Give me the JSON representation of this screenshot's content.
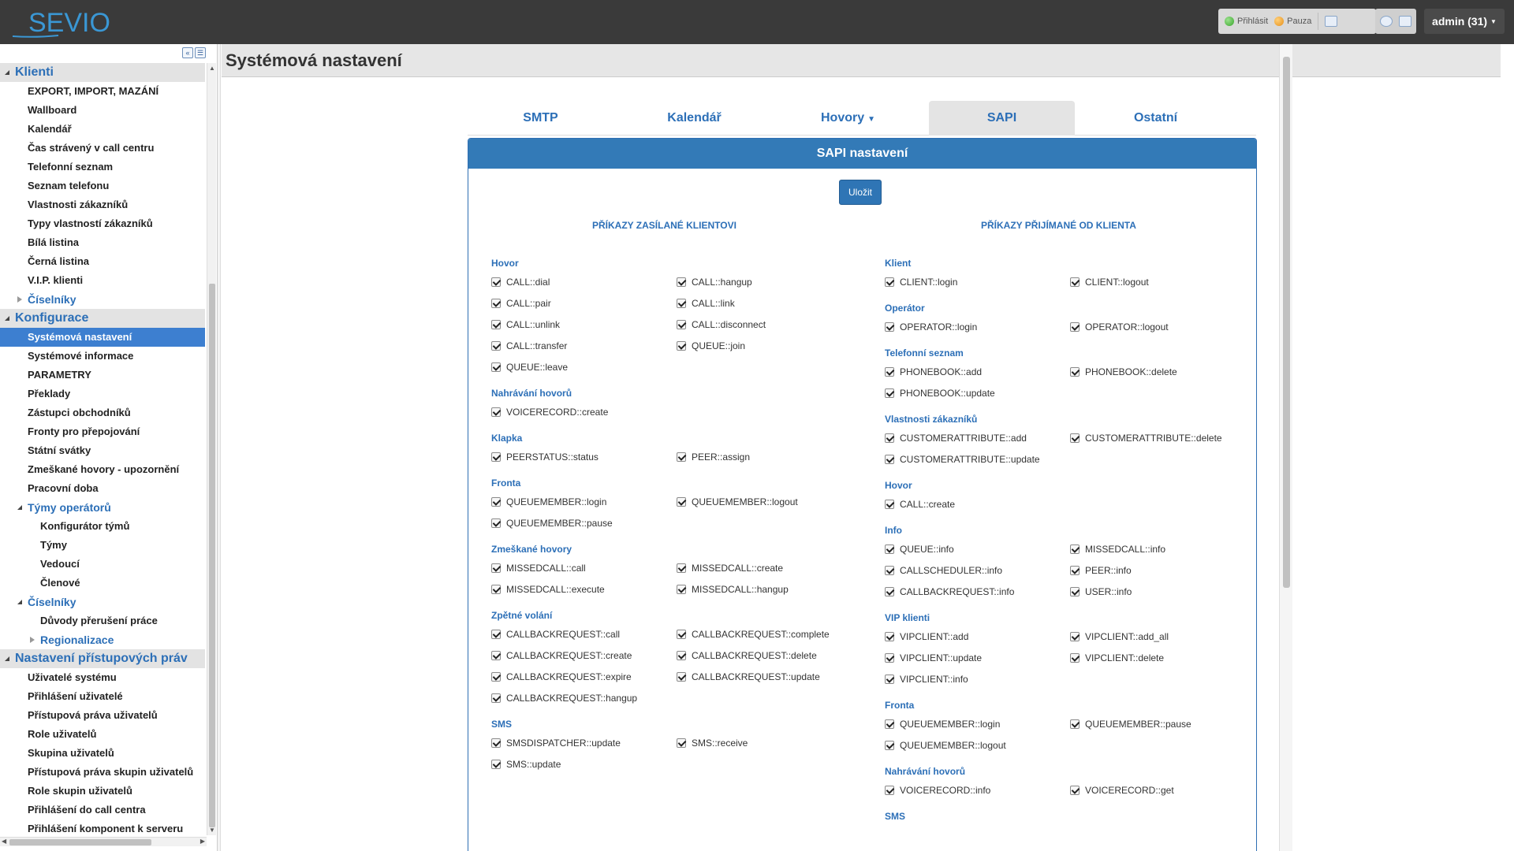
{
  "app": {
    "logo_text": "SEVIO"
  },
  "topbar": {
    "status_login": "Přihlásit",
    "status_pause": "Pauza",
    "user_label": "admin (31)"
  },
  "sidebar": {
    "items": [
      {
        "label": "Klienti",
        "level": 0,
        "tri": "open"
      },
      {
        "label": "EXPORT, IMPORT, MAZÁNÍ",
        "level": 1
      },
      {
        "label": "Wallboard",
        "level": 1
      },
      {
        "label": "Kalendář",
        "level": 1
      },
      {
        "label": "Čas strávený v call centru",
        "level": 1
      },
      {
        "label": "Telefonní seznam",
        "level": 1
      },
      {
        "label": "Seznam telefonu",
        "level": 1
      },
      {
        "label": "Vlastnosti zákazníků",
        "level": 1
      },
      {
        "label": "Typy vlastností zákazníků",
        "level": 1
      },
      {
        "label": "Bílá listina",
        "level": 1
      },
      {
        "label": "Černá listina",
        "level": 1
      },
      {
        "label": "V.I.P. klienti",
        "level": 1
      },
      {
        "label": "Číselníky",
        "level": 1,
        "group": true,
        "tri": "closed"
      },
      {
        "label": "Konfigurace",
        "level": 0,
        "tri": "open"
      },
      {
        "label": "Systémová nastavení",
        "level": 1,
        "active": true
      },
      {
        "label": "Systémové informace",
        "level": 1
      },
      {
        "label": "PARAMETRY",
        "level": 1
      },
      {
        "label": "Překlady",
        "level": 1
      },
      {
        "label": "Zástupci obchodníků",
        "level": 1
      },
      {
        "label": "Fronty pro přepojování",
        "level": 1
      },
      {
        "label": "Státní svátky",
        "level": 1
      },
      {
        "label": "Zmeškané hovory - upozornění",
        "level": 1
      },
      {
        "label": "Pracovní doba",
        "level": 1
      },
      {
        "label": "Týmy operátorů",
        "level": 1,
        "group": true,
        "tri": "open"
      },
      {
        "label": "Konfigurátor týmů",
        "level": 2
      },
      {
        "label": "Týmy",
        "level": 2
      },
      {
        "label": "Vedoucí",
        "level": 2
      },
      {
        "label": "Členové",
        "level": 2
      },
      {
        "label": "Číselníky",
        "level": 1,
        "group": true,
        "tri": "open"
      },
      {
        "label": "Důvody přerušení práce",
        "level": 2
      },
      {
        "label": "Regionalizace",
        "level": 2,
        "group": true,
        "tri": "closed"
      },
      {
        "label": "Nastavení přístupových práv",
        "level": 0,
        "tri": "open"
      },
      {
        "label": "Uživatelé systému",
        "level": 1
      },
      {
        "label": "Přihlášení uživatelé",
        "level": 1
      },
      {
        "label": "Přístupová práva uživatelů",
        "level": 1
      },
      {
        "label": "Role uživatelů",
        "level": 1
      },
      {
        "label": "Skupina uživatelů",
        "level": 1
      },
      {
        "label": "Přístupová práva skupin uživatelů",
        "level": 1
      },
      {
        "label": "Role skupin uživatelů",
        "level": 1
      },
      {
        "label": "Přihlášení do call centra",
        "level": 1
      },
      {
        "label": "Přihlášení komponent k serveru",
        "level": 1
      }
    ]
  },
  "page": {
    "title": "Systémová nastavení"
  },
  "tabs": [
    {
      "label": "SMTP",
      "active": false
    },
    {
      "label": "Kalendář",
      "active": false
    },
    {
      "label": "Hovory",
      "active": false,
      "dropdown": true
    },
    {
      "label": "SAPI",
      "active": true
    },
    {
      "label": "Ostatní",
      "active": false
    }
  ],
  "panel": {
    "title": "SAPI nastavení",
    "save_label": "Uložit",
    "left_heading": "PŘÍKAZY ZASÍLANÉ KLIENTOVI",
    "right_heading": "PŘÍKAZY PŘIJÍMANÉ OD KLIENTA",
    "left_sections": [
      {
        "title": "Hovor",
        "items": [
          "CALL::dial",
          "CALL::hangup",
          "CALL::pair",
          "CALL::link",
          "CALL::unlink",
          "CALL::disconnect",
          "CALL::transfer",
          "QUEUE::join",
          "QUEUE::leave"
        ]
      },
      {
        "title": "Nahrávání hovorů",
        "items": [
          "VOICERECORD::create"
        ]
      },
      {
        "title": "Klapka",
        "items": [
          "PEERSTATUS::status",
          "PEER::assign"
        ]
      },
      {
        "title": "Fronta",
        "items": [
          "QUEUEMEMBER::login",
          "QUEUEMEMBER::logout",
          "QUEUEMEMBER::pause"
        ]
      },
      {
        "title": "Zmeškané hovory",
        "items": [
          "MISSEDCALL::call",
          "MISSEDCALL::create",
          "MISSEDCALL::execute",
          "MISSEDCALL::hangup"
        ]
      },
      {
        "title": "Zpětné volání",
        "items": [
          "CALLBACKREQUEST::call",
          "CALLBACKREQUEST::complete",
          "CALLBACKREQUEST::create",
          "CALLBACKREQUEST::delete",
          "CALLBACKREQUEST::expire",
          "CALLBACKREQUEST::update",
          "CALLBACKREQUEST::hangup"
        ]
      },
      {
        "title": "SMS",
        "items": [
          "SMSDISPATCHER::update",
          "SMS::receive",
          "SMS::update"
        ]
      }
    ],
    "right_sections": [
      {
        "title": "Klient",
        "items": [
          "CLIENT::login",
          "CLIENT::logout"
        ]
      },
      {
        "title": "Operátor",
        "items": [
          "OPERATOR::login",
          "OPERATOR::logout"
        ]
      },
      {
        "title": "Telefonní seznam",
        "items": [
          "PHONEBOOK::add",
          "PHONEBOOK::delete",
          "PHONEBOOK::update"
        ]
      },
      {
        "title": "Vlastnosti zákazníků",
        "items": [
          "CUSTOMERATTRIBUTE::add",
          "CUSTOMERATTRIBUTE::delete",
          "CUSTOMERATTRIBUTE::update"
        ]
      },
      {
        "title": "Hovor",
        "items": [
          "CALL::create"
        ]
      },
      {
        "title": "Info",
        "items": [
          "QUEUE::info",
          "MISSEDCALL::info",
          "CALLSCHEDULER::info",
          "PEER::info",
          "CALLBACKREQUEST::info",
          "USER::info"
        ]
      },
      {
        "title": "VIP klienti",
        "items": [
          "VIPCLIENT::add",
          "VIPCLIENT::add_all",
          "VIPCLIENT::update",
          "VIPCLIENT::delete",
          "VIPCLIENT::info"
        ]
      },
      {
        "title": "Fronta",
        "items": [
          "QUEUEMEMBER::login",
          "QUEUEMEMBER::pause",
          "QUEUEMEMBER::logout"
        ]
      },
      {
        "title": "Nahrávání hovorů",
        "items": [
          "VOICERECORD::info",
          "VOICERECORD::get"
        ]
      },
      {
        "title": "SMS",
        "items": []
      }
    ]
  }
}
